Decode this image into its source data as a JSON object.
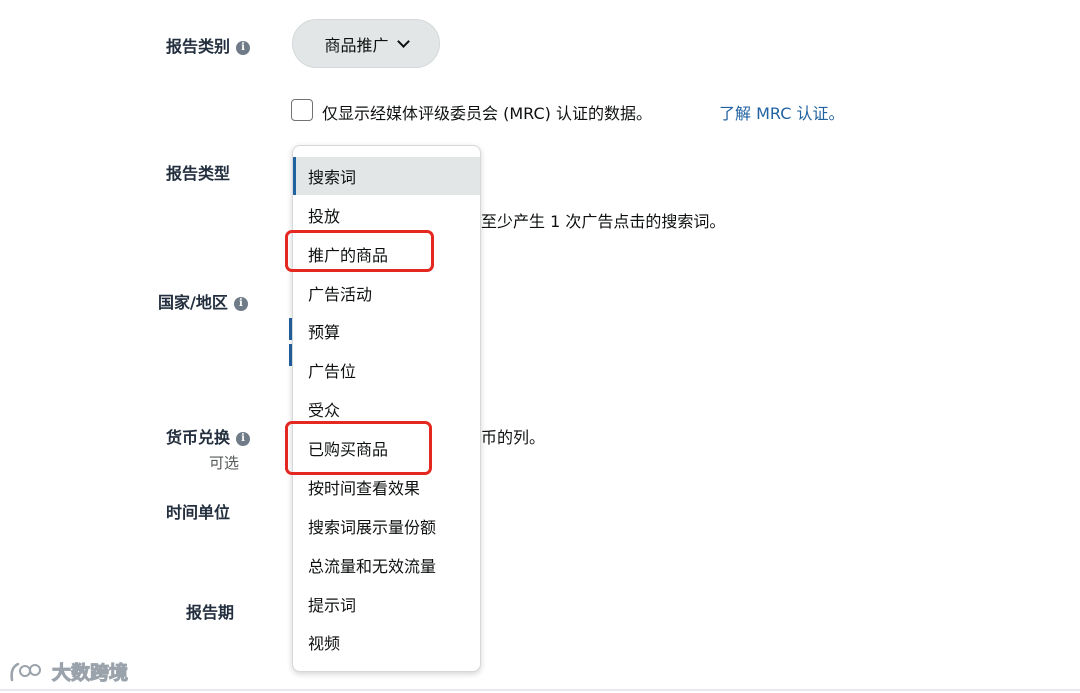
{
  "form": {
    "report_category": {
      "label": "报告类别",
      "selected": "商品推广"
    },
    "mrc": {
      "checkbox_text": "仅显示经媒体评级委员会 (MRC) 认证的数据。",
      "link_text": "了解 MRC 认证。"
    },
    "report_type": {
      "label": "报告类型",
      "description": "至少产生 1 次广告点击的搜索词。"
    },
    "country": {
      "label": "国家/地区"
    },
    "currency": {
      "label": "货币兑换",
      "optional": "可选",
      "description": "币的列。"
    },
    "time_unit": {
      "label": "时间单位"
    },
    "report_period": {
      "label": "报告期"
    }
  },
  "dropdown": {
    "items": [
      "搜索词",
      "投放",
      "推广的商品",
      "广告活动",
      "预算",
      "广告位",
      "受众",
      "已购买商品",
      "按时间查看效果",
      "搜索词展示量份额",
      "总流量和无效流量",
      "提示词",
      "视频"
    ],
    "active_index": 0,
    "highlighted": [
      "推广的商品",
      "已购买商品"
    ]
  },
  "icons": {
    "info": "info-icon",
    "chevron": "chevron-down-icon",
    "highlight_box_color": "#e4271f"
  },
  "watermark": {
    "text": "大数跨境"
  }
}
